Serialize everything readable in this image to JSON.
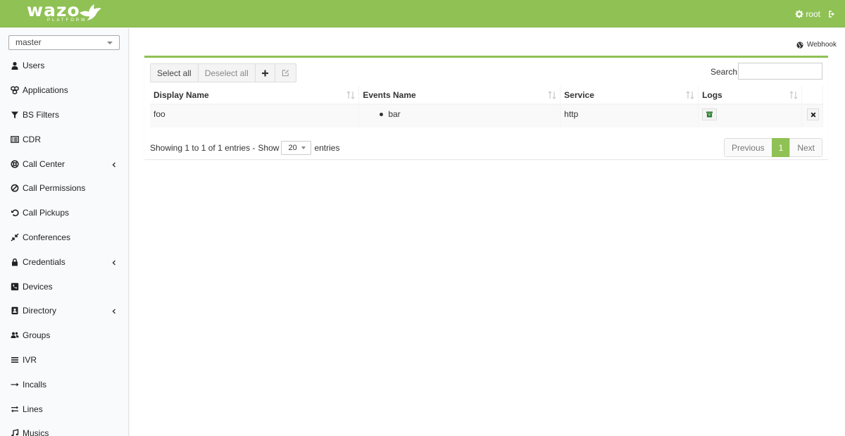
{
  "header": {
    "logo_text": "wazo",
    "logo_subtext": "PLATFORM",
    "user_label": "root",
    "icons": {
      "user": "gear-icon",
      "logout": "sign-out-icon",
      "bird": "bird-logo-icon"
    }
  },
  "sidebar": {
    "tenant": "master",
    "items": [
      {
        "label": "Users",
        "icon": "user-icon",
        "has_submenu": false
      },
      {
        "label": "Applications",
        "icon": "cubes-icon",
        "has_submenu": false
      },
      {
        "label": "BS Filters",
        "icon": "filter-icon",
        "has_submenu": false
      },
      {
        "label": "CDR",
        "icon": "list-alt-icon",
        "has_submenu": false
      },
      {
        "label": "Call Center",
        "icon": "support-icon",
        "has_submenu": true
      },
      {
        "label": "Call Permissions",
        "icon": "ban-icon",
        "has_submenu": false
      },
      {
        "label": "Call Pickups",
        "icon": "undo-icon",
        "has_submenu": false
      },
      {
        "label": "Conferences",
        "icon": "compress-icon",
        "has_submenu": false
      },
      {
        "label": "Credentials",
        "icon": "lock-icon",
        "has_submenu": true
      },
      {
        "label": "Devices",
        "icon": "phone-square-icon",
        "has_submenu": false
      },
      {
        "label": "Directory",
        "icon": "address-book-icon",
        "has_submenu": true
      },
      {
        "label": "Groups",
        "icon": "users-icon",
        "has_submenu": false
      },
      {
        "label": "IVR",
        "icon": "bars-icon",
        "has_submenu": false
      },
      {
        "label": "Incalls",
        "icon": "long-arrow-right-icon",
        "has_submenu": false
      },
      {
        "label": "Lines",
        "icon": "exchange-icon",
        "has_submenu": false
      },
      {
        "label": "Musics",
        "icon": "music-icon",
        "has_submenu": false
      }
    ]
  },
  "breadcrumb": {
    "label": "Webhook",
    "icon": "globe-icon"
  },
  "toolbar": {
    "select_all": "Select all",
    "deselect_all": "Deselect all",
    "add_icon": "plus-icon",
    "edit_icon": "edit-icon"
  },
  "search": {
    "label": "Search:",
    "value": "",
    "placeholder": ""
  },
  "table": {
    "columns": [
      "Display Name",
      "Events Name",
      "Service",
      "Logs"
    ],
    "rows": [
      {
        "display_name": "foo",
        "events": [
          "bar"
        ],
        "service": "http",
        "logs_icon": "archive-icon",
        "delete_icon": "times-icon"
      }
    ]
  },
  "footer": {
    "info": "Showing 1 to 1 of 1 entries -",
    "show_label": "Show",
    "page_length": "20",
    "entries_label": "entries"
  },
  "pagination": {
    "previous": "Previous",
    "current": "1",
    "next": "Next"
  },
  "colors": {
    "brand": "#8fc154",
    "sidebar_bg": "#f9fafc"
  }
}
